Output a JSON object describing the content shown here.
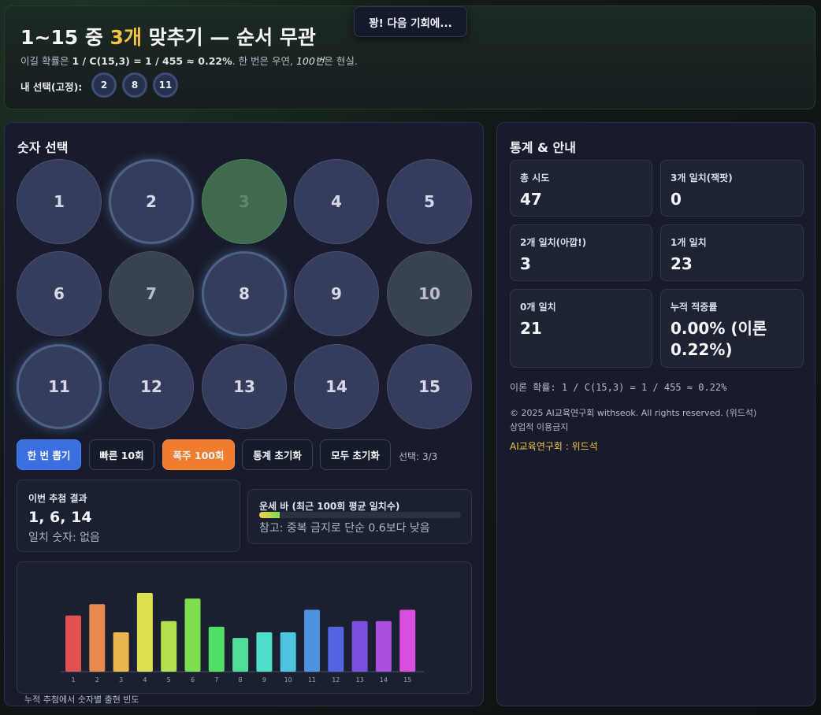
{
  "header": {
    "title_prefix": "1~15 중 ",
    "title_highlight": "3개",
    "title_suffix": " 맞추기 — 순서 무관",
    "subtitle_prefix": "이길 확률은 ",
    "subtitle_formula": "1 / C(15,3) = 1 / 455 ≈ 0.22%",
    "subtitle_mid": ". 한 번은 우연, ",
    "subtitle_italic": "100번",
    "subtitle_suffix": "은 현실.",
    "my_pick_label": "내 선택(고정):",
    "my_picks": [
      "2",
      "8",
      "11"
    ]
  },
  "toast": {
    "text": "꽝! 다음 기회에..."
  },
  "left": {
    "title": "숫자 선택",
    "balls": [
      "1",
      "2",
      "3",
      "4",
      "5",
      "6",
      "7",
      "8",
      "9",
      "10",
      "11",
      "12",
      "13",
      "14",
      "15"
    ],
    "buttons": {
      "draw_once": "한 번 뽑기",
      "fast_10": "빠른 10회",
      "rush_100": "폭주 100회",
      "reset_stats": "통계 초기화",
      "reset_all": "모두 초기화"
    },
    "selection_count": "선택: 3/3",
    "result": {
      "label": "이번 추첨 결과",
      "numbers": "1, 6, 14",
      "match_text": "일치 숫자: 없음"
    },
    "luck_bar": {
      "label": "운세 바 (최근 100회 평균 일치수)",
      "fill_fraction": 0.1,
      "note": "참고: 중복 금지로 단순 0.6보다 낮음"
    },
    "chart_caption": "누적 추첨에서 숫자별 출현 빈도"
  },
  "chart_data": {
    "type": "bar",
    "categories": [
      "1",
      "2",
      "3",
      "4",
      "5",
      "6",
      "7",
      "8",
      "9",
      "10",
      "11",
      "12",
      "13",
      "14",
      "15"
    ],
    "values": [
      10,
      12,
      7,
      14,
      9,
      13,
      8,
      6,
      7,
      7,
      11,
      8,
      9,
      9,
      11
    ],
    "colors": [
      "#e05252",
      "#e8894f",
      "#e8b84f",
      "#dfe04f",
      "#b4e04f",
      "#7ddf4f",
      "#4fdf65",
      "#4fdf99",
      "#4fdfc8",
      "#4fc4df",
      "#4f92df",
      "#5463df",
      "#7d4fdf",
      "#a94fdf",
      "#d84fdf"
    ],
    "title": "",
    "xlabel": "",
    "ylabel": ""
  },
  "right": {
    "title": "통계 & 안내",
    "stats": [
      {
        "label": "총 시도",
        "value": "47"
      },
      {
        "label": "3개 일치(잭팟)",
        "value": "0"
      },
      {
        "label": "2개 일치(아깝!)",
        "value": "3"
      },
      {
        "label": "1개 일치",
        "value": "23"
      },
      {
        "label": "0개 일치",
        "value": "21"
      },
      {
        "label": "누적 적중률",
        "value": "0.00% (이론 0.22%)"
      }
    ],
    "theory": "이론 확률: 1 / C(15,3) = 1 / 455 ≈ 0.22%",
    "copyright": "© 2025 AI교육연구회 withseok. All rights reserved. (위드석)",
    "no_commercial": "상업적 이용금지",
    "credit": "AI교육연구회 : 위드석"
  }
}
